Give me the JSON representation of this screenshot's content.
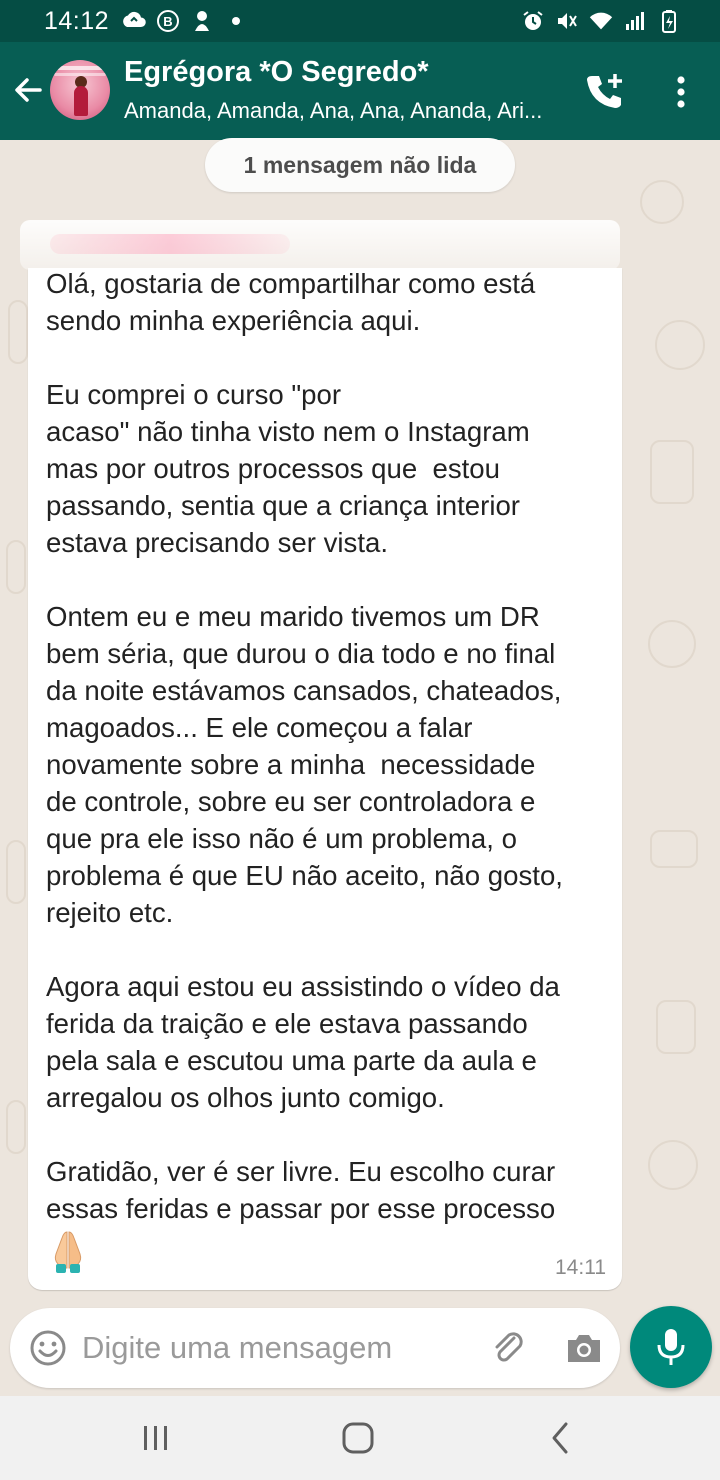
{
  "status_bar": {
    "time": "14:12",
    "left_icons": [
      "cloud-sync-icon",
      "b-badge-icon",
      "cat-icon",
      "dot-icon"
    ],
    "right_icons": [
      "alarm-icon",
      "mute-icon",
      "wifi-icon",
      "signal-icon",
      "battery-icon"
    ]
  },
  "header": {
    "title": "Egrégora *O Segredo*",
    "participants": "Amanda, Amanda, Ana, Ana, Ananda, Ari...",
    "icons": {
      "back": "arrow-back-icon",
      "call": "add-call-icon",
      "menu": "more-vert-icon"
    }
  },
  "chat": {
    "unread_label": "1 mensagem não lida",
    "message": {
      "text": "Olá, gostaria de compartilhar como está\nsendo minha experiência aqui.\n\nEu comprei o curso \"por\nacaso\" não tinha visto nem o Instagram\nmas por outros processos que  estou\npassando, sentia que a criança interior\nestava precisando ser vista.\n\nOntem eu e meu marido tivemos um DR\nbem séria, que durou o dia todo e no final\nda noite estávamos cansados, chateados,\nmagoados... E ele começou a falar\nnovamente sobre a minha  necessidade\nde controle, sobre eu ser controladora e\nque pra ele isso não é um problema, o\nproblema é que EU não aceito, não gosto,\nrejeito etc.\n\nAgora aqui estou eu assistindo o vídeo da\nferida da traição e ele estava passando\npela sala e escutou uma parte da aula e\narregalou os olhos junto comigo.\n\nGratidão, ver é ser livre. Eu escolho curar\nessas feridas e passar por esse processo",
      "emoji": "folded-hands-icon",
      "time": "14:11"
    }
  },
  "input_bar": {
    "placeholder": "Digite uma mensagem",
    "value": "",
    "icons": {
      "emoji": "emoji-icon",
      "attach": "paperclip-icon",
      "camera": "camera-icon",
      "mic": "mic-icon"
    }
  },
  "nav_bar": {
    "icons": [
      "recents-icon",
      "home-icon",
      "back-icon"
    ]
  },
  "colors": {
    "header": "#075e54",
    "status_bar": "#054d44",
    "accent": "#00897b",
    "chat_background": "#ece5dd",
    "bubble": "#ffffff"
  }
}
